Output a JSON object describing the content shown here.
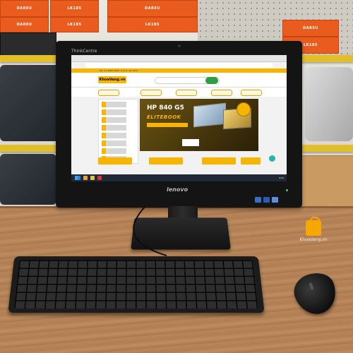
{
  "background": {
    "box_labels": [
      "DAREU",
      "LK185",
      "DAREU",
      "LK185",
      "DAREU",
      "LK185",
      "DAREU",
      "LK185"
    ]
  },
  "monitor": {
    "top_brand": "ThinkCentre",
    "bottom_brand": "lenovo"
  },
  "screen": {
    "info_strip": "Tel: 0 9 6666 6666, P. 8, Q. 10, HCM",
    "logo_text": "KhoaVang.vn",
    "banner_title": "HP 840 G5",
    "banner_subtitle": "ELITEBOOK",
    "clock": "9:41"
  },
  "watermark": {
    "text": "KhoaVang.vn"
  },
  "colors": {
    "brand_yellow": "#f7b500",
    "box_orange": "#ea5b1e",
    "desk_wood": "#b8865a"
  }
}
